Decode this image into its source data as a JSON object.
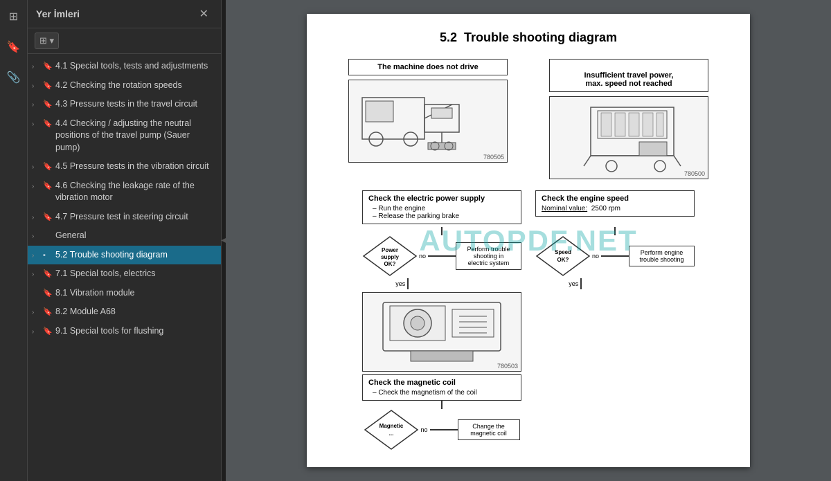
{
  "toolbar": {
    "icons": [
      "⊞",
      "🔖",
      "📎"
    ]
  },
  "sidebar": {
    "title": "Yer İmleri",
    "close_label": "✕",
    "tool_btn_label": "⊞ ▾",
    "items": [
      {
        "id": "item-41",
        "chevron": "›",
        "bookmark": "🔖",
        "label": "4.1 Special tools, tests and adjustments",
        "active": false
      },
      {
        "id": "item-42",
        "chevron": "›",
        "bookmark": "🔖",
        "label": "4.2 Checking the rotation speeds",
        "active": false
      },
      {
        "id": "item-43",
        "chevron": "›",
        "bookmark": "🔖",
        "label": "4.3 Pressure tests in the travel circuit",
        "active": false
      },
      {
        "id": "item-44",
        "chevron": "›",
        "bookmark": "🔖",
        "label": "4.4 Checking / adjusting the neutral positions of the travel pump (Sauer pump)",
        "active": false
      },
      {
        "id": "item-45",
        "chevron": "›",
        "bookmark": "🔖",
        "label": "4.5 Pressure tests in the vibration circuit",
        "active": false
      },
      {
        "id": "item-46",
        "chevron": "›",
        "bookmark": "🔖",
        "label": "4.6 Checking the leakage rate of the vibration motor",
        "active": false
      },
      {
        "id": "item-47",
        "chevron": "›",
        "bookmark": "🔖",
        "label": "4.7 Pressure test in steering circuit",
        "active": false
      },
      {
        "id": "item-general",
        "chevron": "›",
        "bookmark": "",
        "label": "General",
        "active": false
      },
      {
        "id": "item-52",
        "chevron": "›",
        "bookmark": "▪",
        "label": "5.2 Trouble shooting diagram",
        "active": true
      },
      {
        "id": "item-71",
        "chevron": "›",
        "bookmark": "🔖",
        "label": "7.1 Special tools, electrics",
        "active": false
      },
      {
        "id": "item-81",
        "chevron": "",
        "bookmark": "🔖",
        "label": "8.1 Vibration module",
        "active": false
      },
      {
        "id": "item-82",
        "chevron": "›",
        "bookmark": "🔖",
        "label": "8.2 Module A68",
        "active": false
      },
      {
        "id": "item-91",
        "chevron": "›",
        "bookmark": "🔖",
        "label": "9.1 Special tools for flushing",
        "active": false
      }
    ]
  },
  "document": {
    "section": "5.2",
    "title": "Trouble shooting diagram",
    "watermark": "AUTOPDF.NET",
    "left_col": {
      "img_num1": "780505",
      "box1_title": "Check the electric power supply",
      "box1_bullets": [
        "Run the engine",
        "Release the parking brake"
      ],
      "diamond1_label": "Power\nsupply\nOK?",
      "no_label": "no",
      "yes_label": "yes",
      "no_action": "Perform trouble\nshooting in\nelectric system",
      "img_num2": "780503",
      "box2_title": "Check the magnetic coil",
      "box2_bullets": [
        "Check the magnetism of\nthe coil"
      ],
      "diamond2_label": "Magnetic\n...",
      "no_label2": "no",
      "no_action2": "Change the\nmagnetic coil"
    },
    "right_col": {
      "img_num1": "780500",
      "box1_title": "Check the engine speed",
      "box1_nominal": "Nominal value:",
      "box1_value": "2500 rpm",
      "diamond1_label": "Speed\nOK?",
      "no_label": "no",
      "yes_label": "yes",
      "no_action": "Perform engine\ntrouble shooting"
    },
    "left_header": "The machine does not drive",
    "right_header": "Insufficient travel power,\nmax. speed not reached"
  }
}
